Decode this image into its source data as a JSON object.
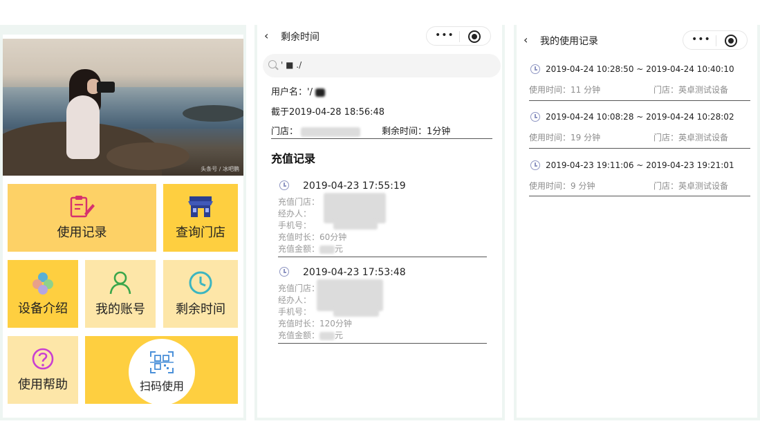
{
  "home": {
    "banner_watermark": "头条号 / 冰吧鹏",
    "tiles": {
      "usage_records": "使用记录",
      "find_store": "查询门店",
      "device_intro": "设备介绍",
      "my_account": "我的账号",
      "remaining_time": "剩余时间",
      "help": "使用帮助",
      "scan": "扫码使用"
    }
  },
  "remaining": {
    "nav": {
      "title": "剩余时间",
      "back": "‹",
      "more": "•••"
    },
    "search": {
      "value": "' ■ ./"
    },
    "user_label": "用户名：",
    "user_value": "'/",
    "cutoff": "截于2019-04-28 18:56:48",
    "store_label": "门店：",
    "remaining_label": "剩余时间：1分钟",
    "section_title": "充值记录",
    "records": [
      {
        "datetime": "2019-04-23 17:55:19",
        "store": "充值门店：",
        "agent": "经办人：",
        "phone": "手机号：",
        "duration": "充值时长：60分钟",
        "amount_label": "充值金额：",
        "amount_unit": "元"
      },
      {
        "datetime": "2019-04-23 17:53:48",
        "store": "充值门店：",
        "agent": "经办人：",
        "phone": "手机号：",
        "duration": "充值时长：120分钟",
        "amount_label": "充值金额：",
        "amount_unit": "元"
      }
    ]
  },
  "usage": {
    "nav": {
      "title": "我的使用记录",
      "back": "‹",
      "more": "•••"
    },
    "records": [
      {
        "range": "2019-04-24 10:28:50 ~ 2019-04-24 10:40:10",
        "duration": "使用时间：11 分钟",
        "store": "门店：英卓测试设备"
      },
      {
        "range": "2019-04-24 10:08:28 ~ 2019-04-24 10:28:02",
        "duration": "使用时间：19 分钟",
        "store": "门店：英卓测试设备"
      },
      {
        "range": "2019-04-23 19:11:06 ~ 2019-04-23 19:21:01",
        "duration": "使用时间：9 分钟",
        "store": "门店：英卓测试设备"
      }
    ]
  },
  "colors": {
    "tile_yellow": "#fdd166",
    "tile_gold": "#fecf40",
    "tile_pale": "#fde6a8",
    "clock_icon": "#8e95c2"
  },
  "icons": {
    "usage_records": "notepad-pen-icon",
    "find_store": "storefront-icon",
    "device_intro": "colored-dots-icon",
    "my_account": "person-outline-icon",
    "remaining_time": "clock-icon",
    "help": "question-circle-icon",
    "scan": "qr-scan-icon"
  }
}
